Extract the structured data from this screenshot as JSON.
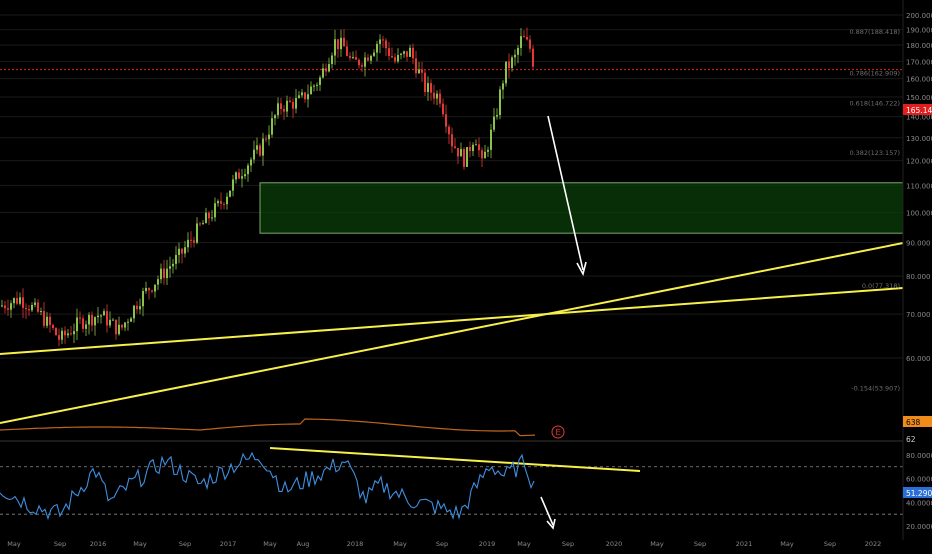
{
  "price_axis": {
    "ticks": [
      "200.000",
      "190.000",
      "180.000",
      "170.000",
      "160.000",
      "150.000",
      "140.000",
      "130.000",
      "120.000",
      "110.000",
      "100.000",
      "90.000",
      "80.000",
      "70.000",
      "60.000"
    ],
    "current_price": "165.140",
    "orange_tag": "638"
  },
  "fib_labels": [
    "0.887(188.418)",
    "0.786(162.909)",
    "0.618(146.722)",
    "0.382(123.157)",
    "0.0(77.318)",
    "-0.154(53.907)"
  ],
  "event_marker": "E",
  "rsi_axis": {
    "ticks": [
      "80.0000",
      "60.0000",
      "40.0000",
      "20.0000"
    ],
    "value_tag": "51.2906",
    "level_label": "62"
  },
  "time_axis": {
    "labels": [
      "May",
      "Sep",
      "2016",
      "May",
      "Sep",
      "2017",
      "May",
      "Aug",
      "2018",
      "May",
      "Sep",
      "2019",
      "May",
      "Sep",
      "2020",
      "May",
      "Sep",
      "2021",
      "May",
      "Sep",
      "2022"
    ]
  },
  "colors": {
    "background": "#000000",
    "bull_candle": "#8bc34a",
    "bear_candle": "#e53935",
    "trendline": "#f7f04a",
    "zone_fill": "#0b3d0b",
    "zone_border": "#7aa86a",
    "arrow": "#ffffff",
    "rsi_line": "#3f8fe0",
    "orange_ma": "#c0651a",
    "price_tag_bg": "#e01e1e",
    "rsi_tag_bg": "#2a6fd6",
    "axis_text": "#8a8a8a"
  },
  "chart_data": {
    "type": "line",
    "title": "",
    "xlabel": "",
    "ylabel": "",
    "y_scale": "log",
    "ylim": [
      45,
      205
    ],
    "last_price": 165.14,
    "x": [
      "2015-05",
      "2015-09",
      "2016-01",
      "2016-05",
      "2016-09",
      "2017-01",
      "2017-05",
      "2017-08",
      "2018-01",
      "2018-05",
      "2018-09",
      "2019-01",
      "2019-05"
    ],
    "series": [
      {
        "values": [
          72,
          68,
          62,
          68,
          80,
          97,
          150,
          178,
          175,
          165,
          135,
          120,
          180
        ]
      }
    ],
    "fib_levels": [
      {
        "label": "0.887(188.418)",
        "price": 188.4
      },
      {
        "label": "0.786(162.909)",
        "price": 162.9
      },
      {
        "label": "0.618(146.722)",
        "price": 146.7
      },
      {
        "label": "0.382(123.157)",
        "price": 123.2
      },
      {
        "label": "0.0(77.318)",
        "price": 77.3
      },
      {
        "label": "-0.154(53.907)",
        "price": 53.9
      }
    ],
    "support_zone": {
      "from_price": 93,
      "to_price": 111
    },
    "rsi": {
      "ylim": [
        15,
        90
      ],
      "levels": [
        70,
        30
      ],
      "last_value": 51.29,
      "x": [
        "2015-05",
        "2015-09",
        "2016-01",
        "2016-05",
        "2016-09",
        "2017-01",
        "2017-05",
        "2017-08",
        "2018-01",
        "2018-05",
        "2018-09",
        "2019-01",
        "2019-05"
      ],
      "values": [
        55,
        35,
        62,
        50,
        40,
        60,
        75,
        55,
        70,
        45,
        40,
        72,
        51
      ]
    }
  }
}
